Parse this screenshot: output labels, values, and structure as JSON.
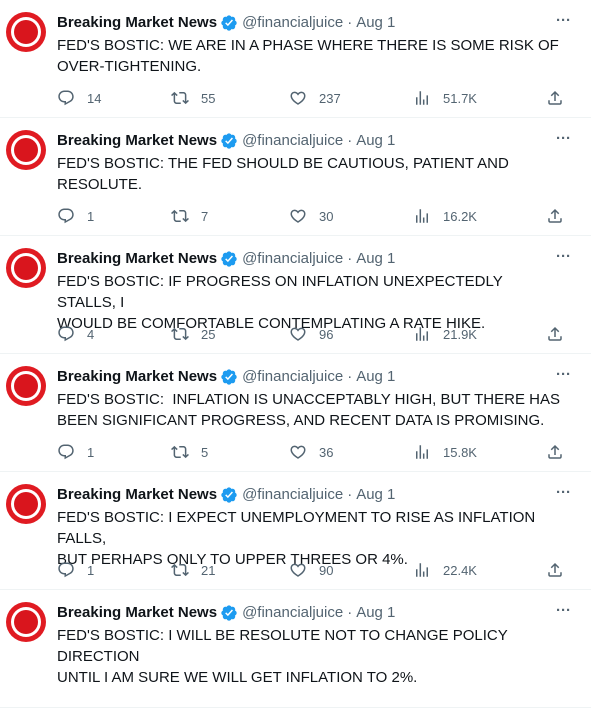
{
  "author": {
    "name": "Breaking Market News",
    "handle": "@financialjuice",
    "separator": "·"
  },
  "more_label": "···",
  "tweets": [
    {
      "date": "Aug 1",
      "text": "FED'S BOSTIC: WE ARE IN A PHASE WHERE THERE IS SOME RISK OF\nOVER-TIGHTENING.",
      "replies": "14",
      "retweets": "55",
      "likes": "237",
      "views": "51.7K"
    },
    {
      "date": "Aug 1",
      "text": "FED'S BOSTIC: THE FED SHOULD BE CAUTIOUS, PATIENT AND\nRESOLUTE.",
      "replies": "1",
      "retweets": "7",
      "likes": "30",
      "views": "16.2K"
    },
    {
      "date": "Aug 1",
      "text": "FED'S BOSTIC: IF PROGRESS ON INFLATION UNEXPECTEDLY STALLS, I\nWOULD BE COMFORTABLE CONTEMPLATING A RATE HIKE.",
      "replies": "4",
      "retweets": "25",
      "likes": "96",
      "views": "21.9K"
    },
    {
      "date": "Aug 1",
      "text": "FED'S BOSTIC:  INFLATION IS UNACCEPTABLY HIGH, BUT THERE HAS\nBEEN SIGNIFICANT PROGRESS, AND RECENT DATA IS PROMISING.",
      "replies": "1",
      "retweets": "5",
      "likes": "36",
      "views": "15.8K"
    },
    {
      "date": "Aug 1",
      "text": "FED'S BOSTIC: I EXPECT UNEMPLOYMENT TO RISE AS INFLATION FALLS,\nBUT PERHAPS ONLY TO UPPER THREES OR 4%.",
      "replies": "1",
      "retweets": "21",
      "likes": "90",
      "views": "22.4K"
    },
    {
      "date": "Aug 1",
      "text": "FED'S BOSTIC: I WILL BE RESOLUTE NOT TO CHANGE POLICY DIRECTION\nUNTIL I AM SURE WE WILL GET INFLATION TO 2%.",
      "replies": "",
      "retweets": "",
      "likes": "",
      "views": ""
    }
  ],
  "colors": {
    "text": "#0f1419",
    "secondary": "#536471",
    "verified": "#1d9bf0",
    "avatar_red": "#e01b22",
    "divider": "#eff3f4"
  }
}
